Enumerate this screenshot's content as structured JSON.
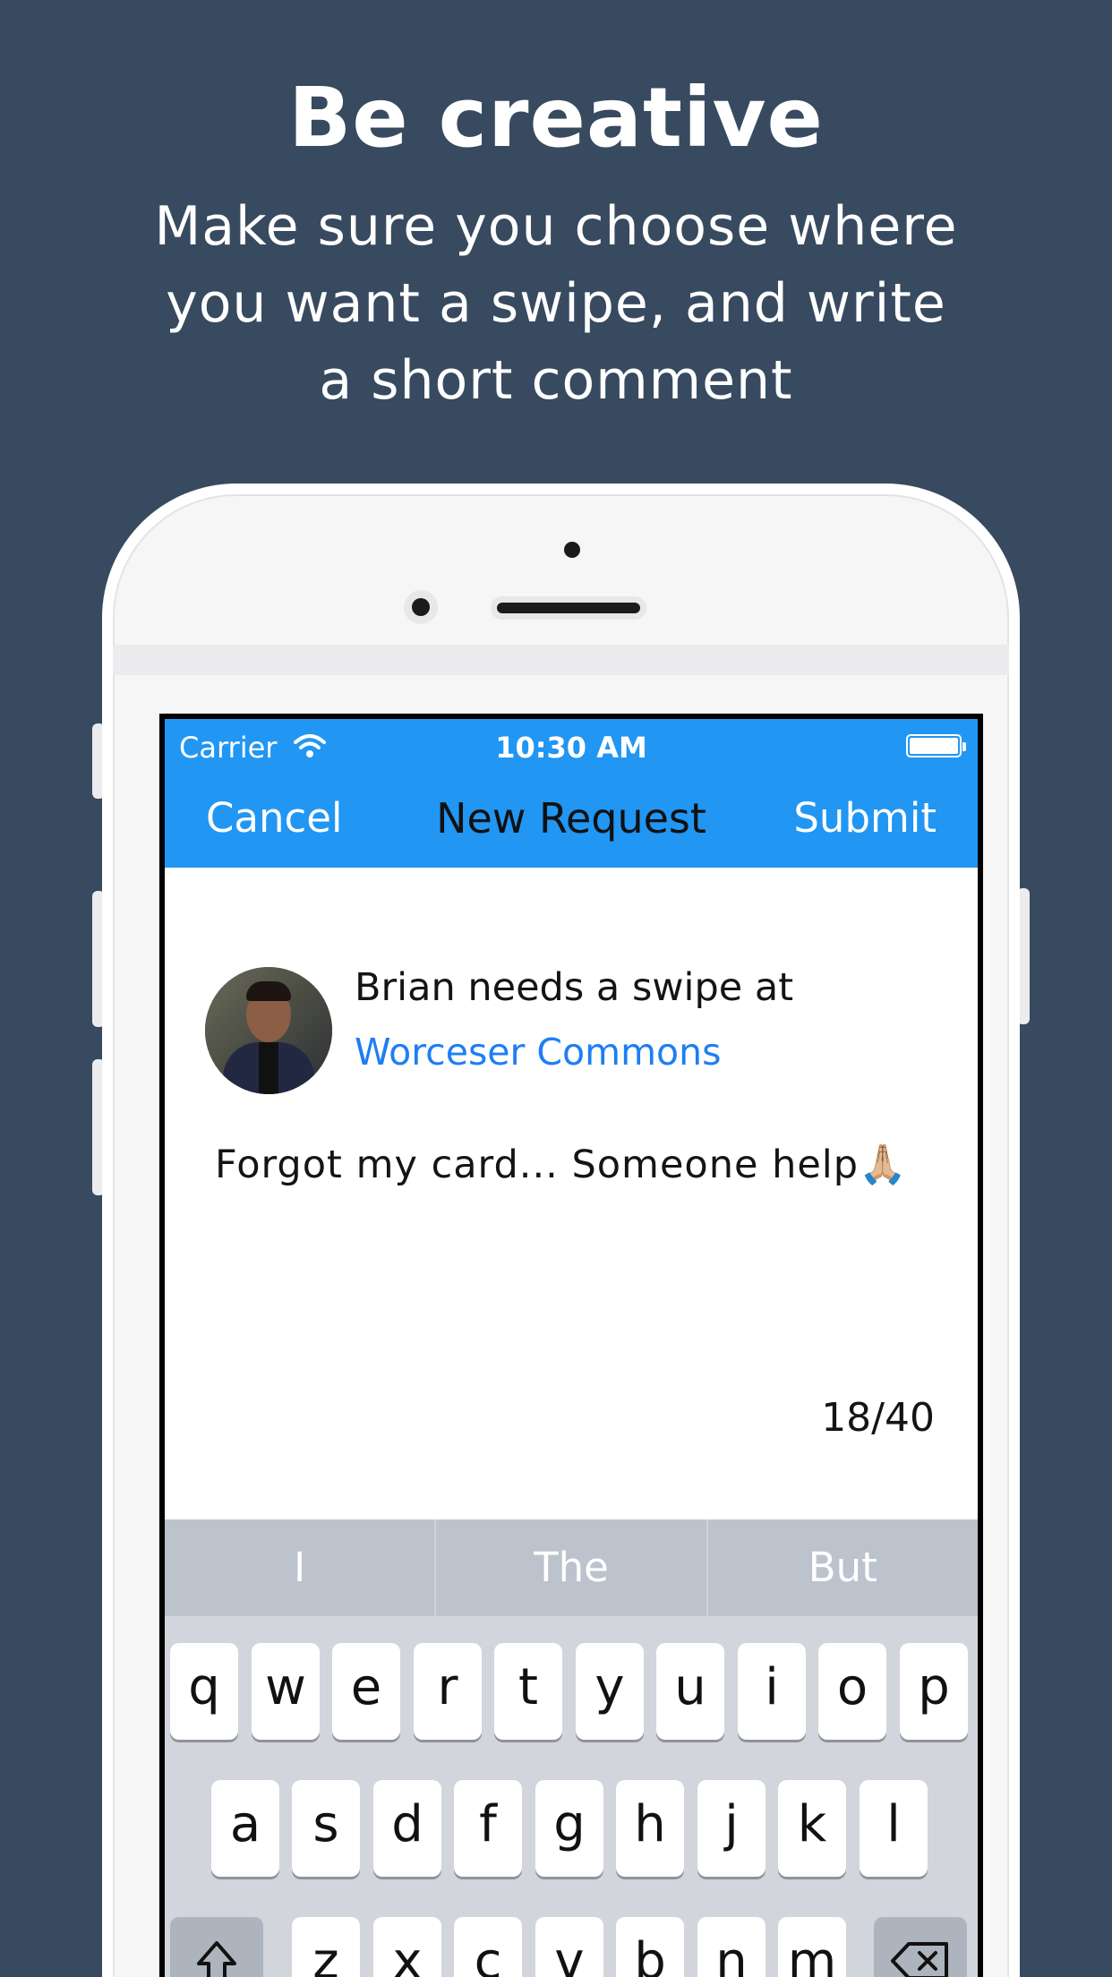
{
  "headline": "Be creative",
  "subline": "Make sure you choose where you want a swipe, and write a short comment",
  "status_bar": {
    "carrier": "Carrier",
    "time": "10:30 AM"
  },
  "nav": {
    "cancel": "Cancel",
    "title": "New Request",
    "submit": "Submit"
  },
  "request": {
    "text": "Brian needs a swipe at",
    "location": "Worceser Commons",
    "comment": "Forgot my card... Someone help🙏🏼",
    "counter": "18/40"
  },
  "suggestions": [
    "I",
    "The",
    "But"
  ],
  "keyboard": {
    "row1": [
      "q",
      "w",
      "e",
      "r",
      "t",
      "y",
      "u",
      "i",
      "o",
      "p"
    ],
    "row2": [
      "a",
      "s",
      "d",
      "f",
      "g",
      "h",
      "j",
      "k",
      "l"
    ],
    "row3": [
      "z",
      "x",
      "c",
      "v",
      "b",
      "n",
      "m"
    ],
    "shift_icon": "shift-icon",
    "delete_icon": "delete-icon"
  },
  "colors": {
    "background": "#374a5f",
    "nav": "#2196f3",
    "link": "#1e7ef4"
  }
}
